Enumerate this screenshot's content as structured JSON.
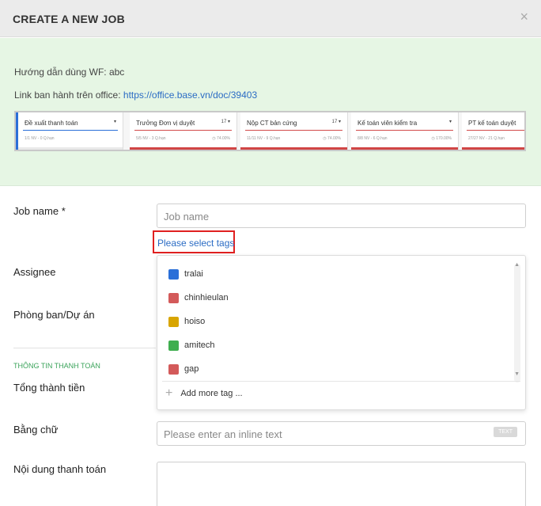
{
  "header": {
    "title": "CREATE A NEW JOB",
    "close": "×"
  },
  "guide": {
    "line1": "Hướng dẫn dùng WF: abc",
    "line2_prefix": "Link ban hành trên office: ",
    "link": "https://office.base.vn/doc/39403"
  },
  "board": {
    "columns": [
      {
        "name": "Đề xuất thanh toán",
        "sub": "1/1 NV - 0 Q.hạn",
        "pct": "",
        "ctl": "▾",
        "bar": "#e9e9e9"
      },
      {
        "name": "Trưởng Đơn vị duyệt",
        "sub": "5/5 NV - 3 Q.hạn",
        "pct": "◷ 74.00%",
        "ctl": "17 ▾",
        "bar": "#d04545"
      },
      {
        "name": "Nộp CT bản cứng",
        "sub": "11/11 NV - 9 Q.hạn",
        "pct": "◷ 74.00%",
        "ctl": "17 ▾",
        "bar": "#d04545"
      },
      {
        "name": "Kế toán viên kiểm tra",
        "sub": "8/8 NV - 6 Q.hạn",
        "pct": "◷ 170.00%",
        "ctl": "▾",
        "bar": "#d04545"
      },
      {
        "name": "PT kế toán duyệt",
        "sub": "27/27 NV - 21 Q.hạn",
        "pct": "",
        "ctl": "",
        "bar": "#d04545"
      }
    ]
  },
  "form": {
    "job_name_label": "Job name *",
    "job_name_placeholder": "Job name",
    "tag_link": "Please select tags",
    "assignee_label": "Assignee",
    "department_label": "Phòng ban/Dự án",
    "section_title": "THÔNG TIN THANH TOÁN",
    "total_label": "Tổng thành tiền",
    "in_words_label": "Bằng chữ",
    "in_words_placeholder": "Please enter an inline text",
    "text_badge": "TEXT",
    "content_label": "Nội dung thanh toán"
  },
  "tags": {
    "items": [
      {
        "name": "tralai",
        "color": "#2a6fd8"
      },
      {
        "name": "chinhieulan",
        "color": "#d35a5a"
      },
      {
        "name": "hoiso",
        "color": "#d8a500"
      },
      {
        "name": "amitech",
        "color": "#3fae4f"
      },
      {
        "name": "gap",
        "color": "#d35a5a"
      }
    ],
    "add_more": "Add more tag ..."
  }
}
